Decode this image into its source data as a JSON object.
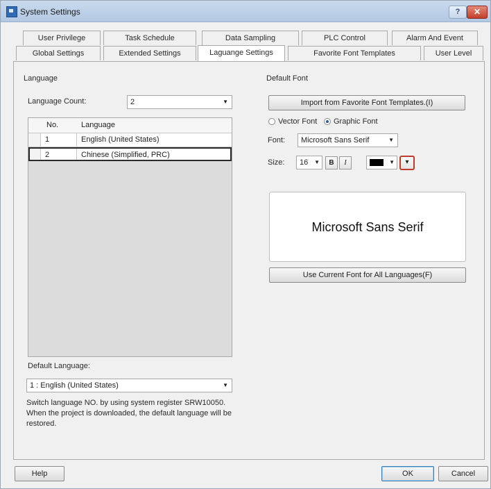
{
  "window": {
    "title": "System Settings"
  },
  "tabs_row1": [
    "User Privilege",
    "Task Schedule",
    "Data Sampling",
    "PLC Control",
    "Alarm And Event"
  ],
  "tabs_row2": [
    "Global Settings",
    "Extended Settings",
    "Laguange Settings",
    "Favorite Font Templates",
    "User Level"
  ],
  "active_tab": "Laguange Settings",
  "language": {
    "group_label": "Language",
    "count_label": "Language Count:",
    "count_value": "2",
    "columns": {
      "no": "No.",
      "language": "Language"
    },
    "rows": [
      {
        "no": "1",
        "language": "English (United States)"
      },
      {
        "no": "2",
        "language": "Chinese (Simplified, PRC)"
      }
    ],
    "default_label": "Default Language:",
    "default_value": "1 : English (United States)",
    "note": "Switch language NO. by using system register SRW10050. When the project is downloaded, the default language will be restored."
  },
  "default_font": {
    "group_label": "Default Font",
    "import_button": "Import from Favorite Font Templates.(I)",
    "vector_font": "Vector Font",
    "graphic_font": "Graphic Font",
    "selected_font_type": "Graphic Font",
    "font_label": "Font:",
    "font_value": "Microsoft Sans Serif",
    "size_label": "Size:",
    "size_value": "16",
    "bold": "B",
    "italic": "I",
    "color": "#000000",
    "preview_text": "Microsoft Sans Serif",
    "apply_button": "Use Current Font for All Languages(F)"
  },
  "footer": {
    "help": "Help",
    "ok": "OK",
    "cancel": "Cancel"
  }
}
